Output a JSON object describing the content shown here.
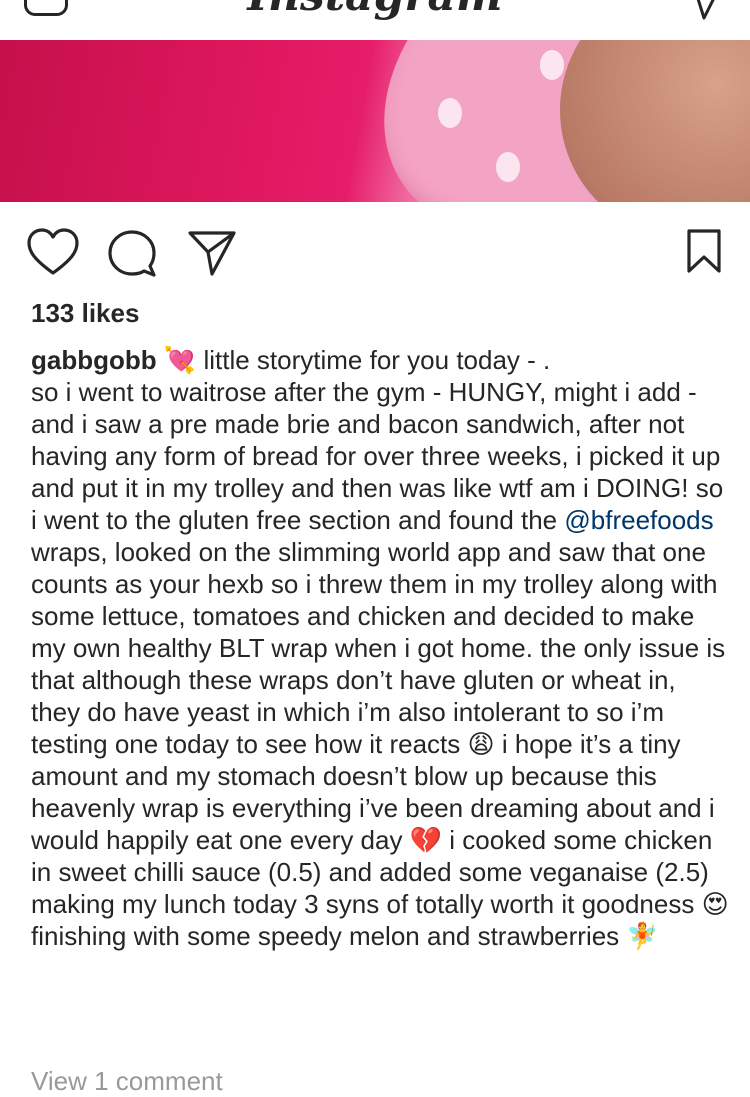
{
  "app": {
    "name": "Instagram"
  },
  "post": {
    "likes": "133 likes",
    "username": "gabbgobb",
    "caption": {
      "line1_emoji": "💘",
      "line1_text": " little storytime for you today - .",
      "part_before_mention": "\nso i went to waitrose after the gym - HUNGY, might i add - and i saw a pre made brie and bacon sandwich, after not having any form of bread for over three weeks, i picked it up and put it in my trolley and then was like wtf am i DOING! so i went to the gluten free section and found the ",
      "mention": "@bfreefoods",
      "part_after_mention": " wraps, looked on the slimming world app and saw that one counts as your hexb so i threw them in my trolley along with some lettuce, tomatoes and chicken and decided to make my own healthy BLT wrap when i got home. the only issue is that although these wraps don’t have gluten or wheat in, they do have yeast in which i’m also intolerant to so i’m testing one today to see how it reacts ",
      "emoji_weary": "😩",
      "part_3": " i hope it’s a tiny amount and my stomach doesn’t blow up because this heavenly wrap is everything i’ve been dreaming about and i would happily eat one every day ",
      "emoji_broken_heart": "💔",
      "part_4": " i cooked some chicken in sweet chilli sauce (0.5) and added some veganaise (2.5) making my lunch today 3 syns of totally worth it goodness ",
      "emoji_heart_eyes": "😍",
      "part_5": " finishing with some speedy melon and strawberries ",
      "emoji_fairy": "🧚"
    },
    "view_comments": "View 1 comment"
  },
  "icons": {
    "camera": "camera-icon",
    "direct": "direct-message-icon",
    "like": "heart-icon",
    "comment": "comment-icon",
    "share": "share-icon",
    "save": "bookmark-icon"
  },
  "colors": {
    "text": "#262626",
    "mention": "#003569",
    "muted": "#999999"
  }
}
